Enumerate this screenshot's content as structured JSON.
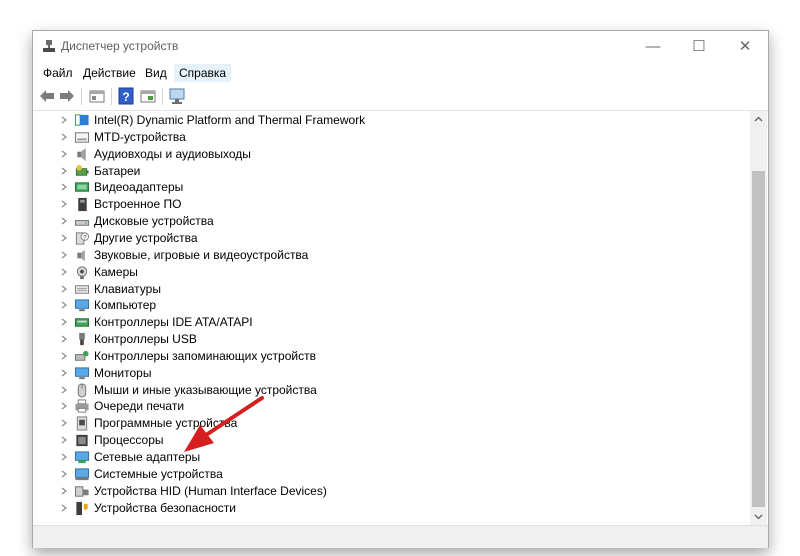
{
  "window": {
    "title": "Диспетчер устройств",
    "icon": "device-manager-icon",
    "controls": {
      "minimize": "—",
      "maximize": "☐",
      "close": "✕"
    }
  },
  "menu": [
    {
      "label": "Файл"
    },
    {
      "label": "Действие"
    },
    {
      "label": "Вид"
    },
    {
      "label": "Справка",
      "active": true
    }
  ],
  "toolbar": [
    "back-icon",
    "forward-icon",
    "properties-icon",
    "help-icon",
    "show-hidden-icon",
    "monitor-scan-icon"
  ],
  "tree": {
    "items": [
      {
        "label": "Intel(R) Dynamic Platform and Thermal Framework",
        "icon": "chip-blue-icon"
      },
      {
        "label": "MTD-устройства",
        "icon": "drive-icon"
      },
      {
        "label": "Аудиовходы и аудиовыходы",
        "icon": "speaker-icon"
      },
      {
        "label": "Батареи",
        "icon": "battery-icon"
      },
      {
        "label": "Видеоадаптеры",
        "icon": "display-adapter-icon"
      },
      {
        "label": "Встроенное ПО",
        "icon": "firmware-icon"
      },
      {
        "label": "Дисковые устройства",
        "icon": "disk-icon"
      },
      {
        "label": "Другие устройства",
        "icon": "unknown-device-icon"
      },
      {
        "label": "Звуковые, игровые и видеоустройства",
        "icon": "sound-icon"
      },
      {
        "label": "Камеры",
        "icon": "camera-icon"
      },
      {
        "label": "Клавиатуры",
        "icon": "keyboard-icon"
      },
      {
        "label": "Компьютер",
        "icon": "computer-icon"
      },
      {
        "label": "Контроллеры IDE ATA/ATAPI",
        "icon": "ide-controller-icon"
      },
      {
        "label": "Контроллеры USB",
        "icon": "usb-icon"
      },
      {
        "label": "Контроллеры запоминающих устройств",
        "icon": "storage-controller-icon"
      },
      {
        "label": "Мониторы",
        "icon": "monitor-icon"
      },
      {
        "label": "Мыши и иные указывающие устройства",
        "icon": "mouse-icon"
      },
      {
        "label": "Очереди печати",
        "icon": "printer-icon"
      },
      {
        "label": "Программные устройства",
        "icon": "software-device-icon"
      },
      {
        "label": "Процессоры",
        "icon": "processor-icon"
      },
      {
        "label": "Сетевые адаптеры",
        "icon": "network-adapter-icon"
      },
      {
        "label": "Системные устройства",
        "icon": "system-device-icon"
      },
      {
        "label": "Устройства HID (Human Interface Devices)",
        "icon": "hid-icon"
      },
      {
        "label": "Устройства безопасности",
        "icon": "security-device-icon"
      }
    ]
  },
  "annotation": {
    "color": "#d62020"
  }
}
